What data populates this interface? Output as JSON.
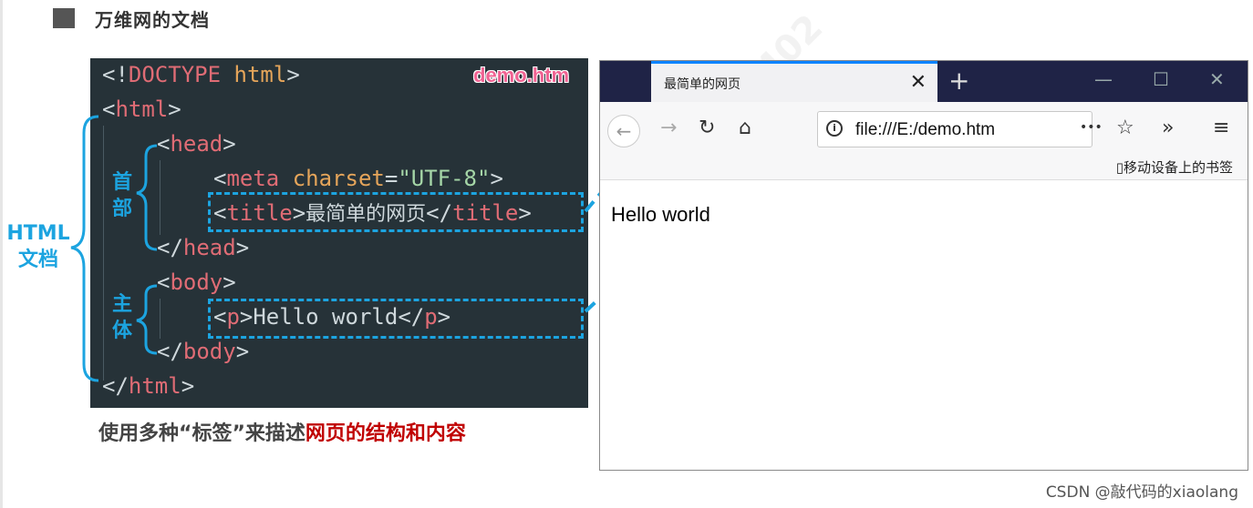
{
  "section": {
    "title": "万维网的文档"
  },
  "code": {
    "filename": "demo.htm",
    "doctype_open": "<!",
    "doctype_kw": "DOCTYPE",
    "doctype_rest": " html",
    "lt": "<",
    "gt": ">",
    "lt_slash": "</",
    "html": "html",
    "head": "head",
    "meta": "meta",
    "charset_attr": "charset",
    "eq": "=",
    "charset_val": "\"UTF-8\"",
    "title": "title",
    "title_text": "最简单的网页",
    "body": "body",
    "p": "p",
    "p_text": "Hello world"
  },
  "labels": {
    "document": "HTML\n文档",
    "head": "首\n部",
    "body": "主\n体"
  },
  "caption": {
    "normal": "使用多种“标签”来描述",
    "highlight": "网页的结构和内容"
  },
  "browser": {
    "tab_title": "最简单的网页",
    "tab_close": "✕",
    "new_tab": "+",
    "minimize": "—",
    "maximize": "☐",
    "close": "✕",
    "url": "file:///E:/demo.htm",
    "more": "•••",
    "bookmarks": "移动设备上的书签",
    "page_text": "Hello world"
  },
  "credit": "CSDN @敲代码的xiaolang",
  "colors": {
    "accent": "#1ca4e0",
    "code_bg": "#263238",
    "tag": "#e06c75",
    "highlight_red": "#c00000"
  }
}
